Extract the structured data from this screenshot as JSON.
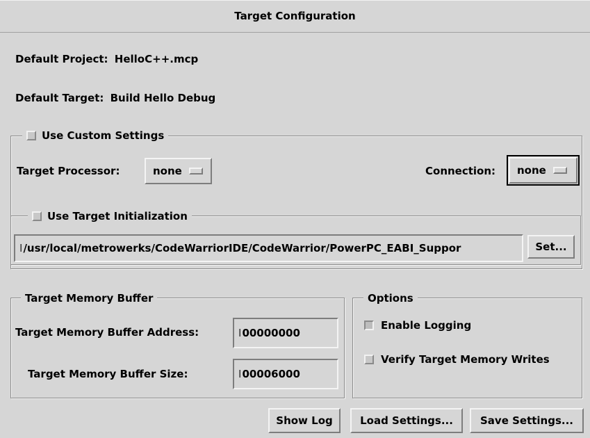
{
  "window": {
    "title": "Target Configuration"
  },
  "project": {
    "label": "Default Project:",
    "value": "HelloC++.mcp"
  },
  "target": {
    "label": "Default Target:",
    "value": "Build Hello Debug"
  },
  "custom_settings": {
    "checkbox_label": "Use Custom Settings",
    "checked": false,
    "processor_label": "Target Processor:",
    "processor_value": "none",
    "connection_label": "Connection:",
    "connection_value": "none"
  },
  "target_init": {
    "checkbox_label": "Use Target Initialization",
    "checked": false,
    "path": "/usr/local/metrowerks/CodeWarriorIDE/CodeWarrior/PowerPC_EABI_Suppor",
    "set_button": "Set..."
  },
  "memory_buffer": {
    "legend": "Target Memory Buffer",
    "address_label": "Target Memory Buffer Address:",
    "address_value": "00000000",
    "size_label": "Target Memory Buffer Size:",
    "size_value": "00006000"
  },
  "options": {
    "legend": "Options",
    "enable_logging_label": "Enable Logging",
    "enable_logging_checked": false,
    "verify_writes_label": "Verify Target Memory Writes",
    "verify_writes_checked": false
  },
  "buttons": {
    "show_log": "Show Log",
    "load_settings": "Load Settings...",
    "save_settings": "Save Settings..."
  }
}
